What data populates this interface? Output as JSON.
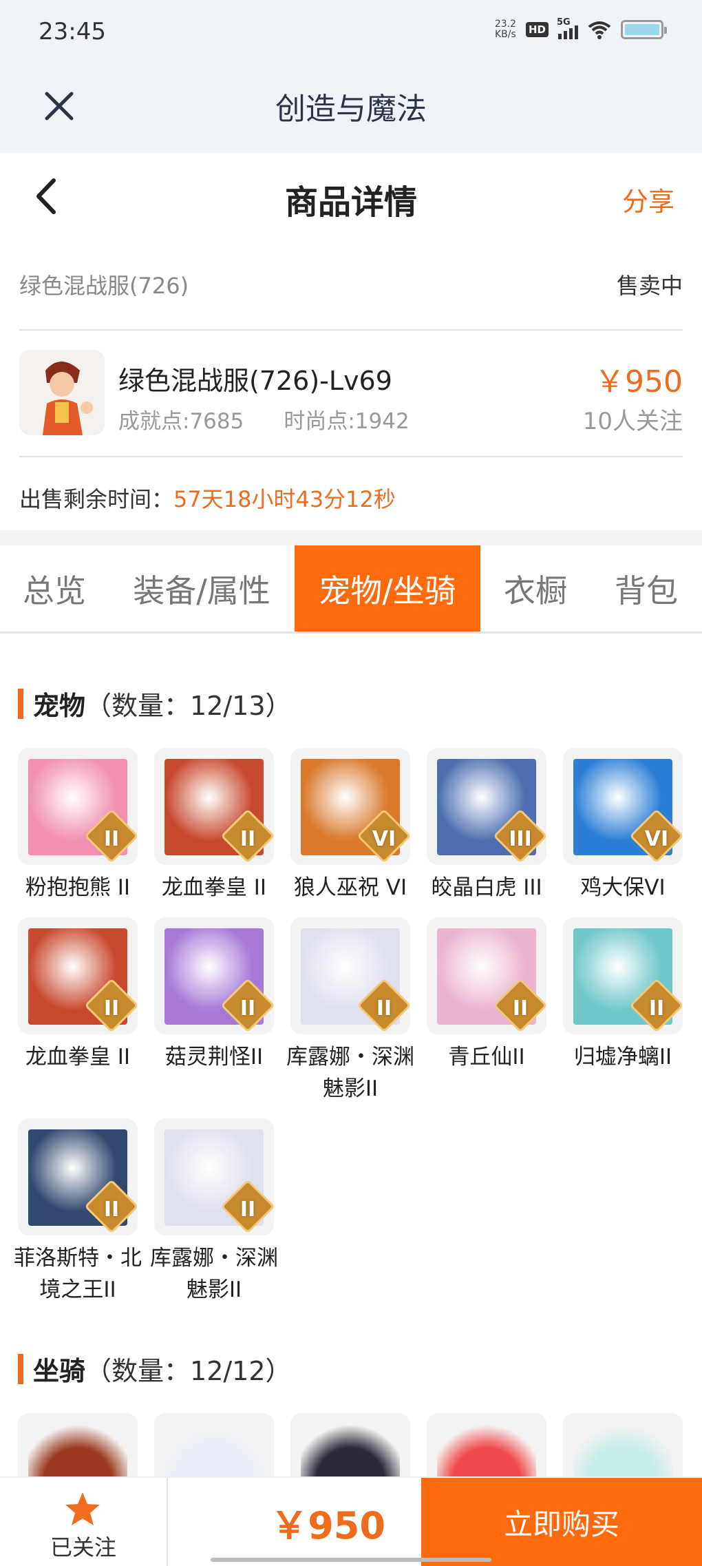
{
  "status_bar": {
    "time": "23:45",
    "net_speed_value": "23.2",
    "net_speed_unit": "KB/s",
    "hd": "HD",
    "network": "5G"
  },
  "app_bar": {
    "title": "创造与魔法"
  },
  "page_header": {
    "title": "商品详情",
    "share": "分享"
  },
  "summary": {
    "name": "绿色混战服(726)",
    "status": "售卖中"
  },
  "product": {
    "name": "绿色混战服(726)-Lv69",
    "achievement": "成就点:7685",
    "fashion": "时尚点:1942",
    "price": "￥950",
    "followers": "10人关注"
  },
  "remaining": {
    "label": "出售剩余时间：",
    "value": "57天18小时43分12秒"
  },
  "tabs": [
    {
      "label": "总览",
      "active": false
    },
    {
      "label": "装备/属性",
      "active": false
    },
    {
      "label": "宠物/坐骑",
      "active": true
    },
    {
      "label": "衣橱",
      "active": false
    },
    {
      "label": "背包",
      "active": false
    }
  ],
  "pets_section": {
    "label": "宠物",
    "count": "（数量：12/13）"
  },
  "pets": [
    {
      "name": "粉抱抱熊 II",
      "rank": "II",
      "color": "#f28fb0"
    },
    {
      "name": "龙血拳皇 II",
      "rank": "II",
      "color": "#c84a2e"
    },
    {
      "name": "狼人巫祝 VI",
      "rank": "VI",
      "color": "#d9782b"
    },
    {
      "name": "皎晶白虎 III",
      "rank": "III",
      "color": "#4f6fb0"
    },
    {
      "name": "鸡大保VI",
      "rank": "VI",
      "color": "#2b7fd6"
    },
    {
      "name": "龙血拳皇 II",
      "rank": "II",
      "color": "#c84a2e"
    },
    {
      "name": "菇灵荆怪II",
      "rank": "II",
      "color": "#a77ad8"
    },
    {
      "name": "库露娜・深渊魅影II",
      "rank": "II",
      "color": "#dfe0ee"
    },
    {
      "name": "青丘仙II",
      "rank": "II",
      "color": "#eab4cf"
    },
    {
      "name": "归墟净螭II",
      "rank": "II",
      "color": "#6fc7c9"
    },
    {
      "name": "菲洛斯特・北境之王II",
      "rank": "II",
      "color": "#33496f"
    },
    {
      "name": "库露娜・深渊魅影II",
      "rank": "II",
      "color": "#dfe0ee"
    }
  ],
  "mounts_section": {
    "label": "坐骑",
    "count": "（数量：12/12）"
  },
  "mounts": [
    {
      "color": "#9b3a1e"
    },
    {
      "color": "#e9eef8"
    },
    {
      "color": "#2a2a38"
    },
    {
      "color": "#f24a4a"
    },
    {
      "color": "#c7ebe9"
    }
  ],
  "bottom_bar": {
    "follow_label": "已关注",
    "price": "￥950",
    "buy_label": "立即购买"
  },
  "colors": {
    "accent": "#ee6c1e",
    "tab_active": "#ff6a0d"
  }
}
